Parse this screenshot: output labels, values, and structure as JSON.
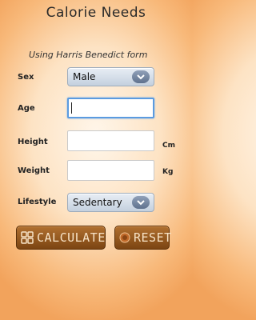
{
  "app_title": "Calorie Needs",
  "subtitle": "Using Harris Benedict form",
  "form": {
    "sex": {
      "label": "Sex",
      "value": "Male",
      "arrow_icon": "chevron-down-icon"
    },
    "age": {
      "label": "Age",
      "value": ""
    },
    "height": {
      "label": "Height",
      "value": "",
      "unit": "Cm"
    },
    "weight": {
      "label": "Weight",
      "value": "",
      "unit": "Kg"
    },
    "lifestyle": {
      "label": "Lifestyle",
      "value": "Sedentary",
      "arrow_icon": "chevron-down-icon"
    }
  },
  "buttons": {
    "calculate": {
      "label": "CALCULATE",
      "icon": "calculator-icon"
    },
    "reset": {
      "label": "RESET",
      "icon": "reset-circle-icon"
    }
  },
  "colors": {
    "accent": "#5b9be0",
    "button": "#8f5520",
    "button_text": "#f7e3c7",
    "background": "#fde3c4"
  }
}
